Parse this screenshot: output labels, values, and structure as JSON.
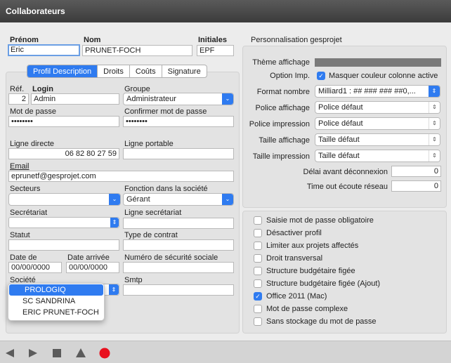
{
  "window": {
    "title": "Collaborateurs"
  },
  "identity": {
    "prenom_label": "Prénom",
    "prenom_value": "Eric",
    "nom_label": "Nom",
    "nom_value": "PRUNET-FOCH",
    "initiales_label": "Initiales",
    "initiales_value": "EPF"
  },
  "tabs": [
    "Profil Description",
    "Droits",
    "Coûts",
    "Signature"
  ],
  "profile": {
    "ref_label": "Réf.",
    "ref_value": "2",
    "login_label": "Login",
    "login_value": "Admin",
    "groupe_label": "Groupe",
    "groupe_value": "Administrateur",
    "password_label": "Mot de passe",
    "password_value": "••••••••",
    "confirm_label": "Confirmer mot de passe",
    "confirm_value": "••••••••",
    "ligne_directe_label": "Ligne directe",
    "ligne_directe_value": "06 82 80 27 59",
    "ligne_portable_label": "Ligne portable",
    "ligne_portable_value": "",
    "email_label": "Email",
    "email_value": "eprunetf@gesprojet.com",
    "secteurs_label": "Secteurs",
    "secteurs_value": "",
    "fonction_label": "Fonction dans la société",
    "fonction_value": "Gérant",
    "secretariat_label": "Secrétariat",
    "secretariat_value": "",
    "ligne_secretariat_label": "Ligne secrétariat",
    "ligne_secretariat_value": "",
    "statut_label": "Statut",
    "statut_value": "",
    "type_contrat_label": "Type de contrat",
    "type_contrat_value": "",
    "date_de_label": "Date de",
    "date_de_value": "00/00/0000",
    "date_arrivee_label": "Date arrivée",
    "date_arrivee_value": "00/00/0000",
    "secu_label": "Numéro de sécurité sociale",
    "secu_value": "",
    "societe_label": "Société",
    "smtp_label": "Smtp",
    "smtp_value": "",
    "societe_options": [
      "PROLOGIQ",
      "SC SANDRINA",
      "ERIC PRUNET-FOCH"
    ]
  },
  "personalisation": {
    "section_title": "Personnalisation gesprojet",
    "theme_label": "Thème affichage",
    "option_imp_label": "Option Imp.",
    "option_imp_checkbox": "Masquer couleur colonne active",
    "format_nombre_label": "Format nombre",
    "format_nombre_value": "Milliard1 : ## ### ### ##0,...",
    "police_affichage_label": "Police affichage",
    "police_affichage_value": "Police défaut",
    "police_impression_label": "Police impression",
    "police_impression_value": "Police défaut",
    "taille_affichage_label": "Taille affichage",
    "taille_affichage_value": "Taille défaut",
    "taille_impression_label": "Taille impression",
    "taille_impression_value": "Taille défaut",
    "delai_label": "Délai avant déconnexion",
    "delai_value": "0",
    "timeout_label": "Time out écoute réseau",
    "timeout_value": "0"
  },
  "options": [
    {
      "label": "Saisie mot de passe obligatoire",
      "checked": false
    },
    {
      "label": "Désactiver profil",
      "checked": false
    },
    {
      "label": "Limiter aux projets affectés",
      "checked": false
    },
    {
      "label": "Droit transversal",
      "checked": false
    },
    {
      "label": "Structure budgétaire figée",
      "checked": false
    },
    {
      "label": "Structure budgétaire figée (Ajout)",
      "checked": false
    },
    {
      "label": "Office 2011 (Mac)",
      "checked": true
    },
    {
      "label": "Mot de passe complexe",
      "checked": false
    },
    {
      "label": "Sans stockage du mot de passe",
      "checked": false
    }
  ],
  "icons": {
    "check": "✓",
    "select_arrows": "⇕",
    "select_chevron": "⌄"
  },
  "colors": {
    "accent": "#2f7bf0",
    "record_button": "#e8101e"
  }
}
